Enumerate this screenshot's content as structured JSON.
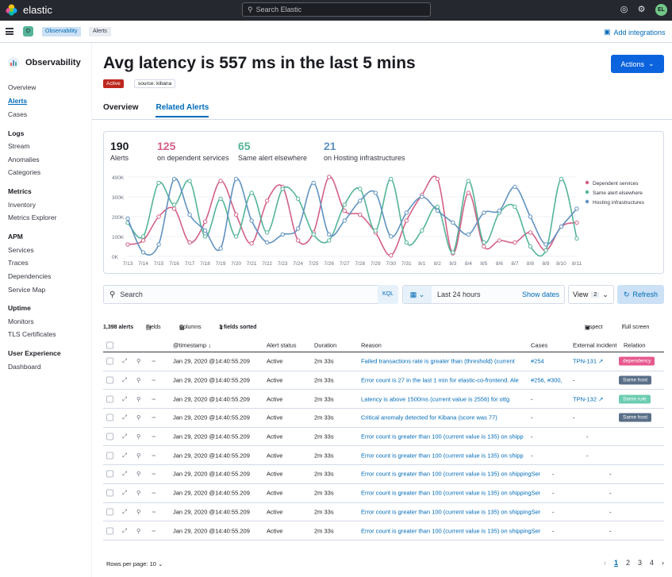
{
  "topbar": {
    "brand": "elastic",
    "search_placeholder": "Search Elastic",
    "avatar_initials": "EL"
  },
  "breadcrumbs": {
    "space_initial": "D",
    "items": [
      "Observability",
      "Alerts"
    ],
    "add_integrations": "Add integrations"
  },
  "sidebar": {
    "title": "Observability",
    "sections": [
      {
        "heading": "",
        "items": [
          "Overview",
          "Alerts",
          "Cases"
        ]
      },
      {
        "heading": "Logs",
        "items": [
          "Stream",
          "Anomalies",
          "Categories"
        ]
      },
      {
        "heading": "Metrics",
        "items": [
          "Inventory",
          "Metrics Explorer"
        ]
      },
      {
        "heading": "APM",
        "items": [
          "Services",
          "Traces",
          "Dependencies",
          "Service Map"
        ]
      },
      {
        "heading": "Uptime",
        "items": [
          "Monitors",
          "TLS Certificates"
        ]
      },
      {
        "heading": "User Experience",
        "items": [
          "Dashboard"
        ]
      }
    ],
    "active_item": "Alerts"
  },
  "page": {
    "title": "Avg latency is 557 ms in the last 5 mins",
    "actions_label": "Actions",
    "status_badge": "Active",
    "source_badge": "source: kibana",
    "tabs": [
      "Overview",
      "Related Alerts"
    ],
    "selected_tab": "Related Alerts"
  },
  "stats": [
    {
      "value": "190",
      "label": "Alerts",
      "color": "#1a1c21"
    },
    {
      "value": "125",
      "label": "on dependent services",
      "color": "#d36086"
    },
    {
      "value": "65",
      "label": "Same alert elsewhere",
      "color": "#54b399"
    },
    {
      "value": "21",
      "label": "on Hosting infrastructures",
      "color": "#6092c0"
    }
  ],
  "chart_data": {
    "type": "line",
    "categories": [
      "7/13",
      "7/14",
      "7/15",
      "7/16",
      "7/17",
      "7/18",
      "7/19",
      "7/20",
      "7/21",
      "7/22",
      "7/23",
      "7/24",
      "7/25",
      "7/26",
      "7/27",
      "7/28",
      "7/29",
      "7/30",
      "7/31",
      "8/1",
      "8/2",
      "8/3",
      "8/4",
      "8/5",
      "8/6",
      "8/7",
      "8/8",
      "8/9",
      "8/10",
      "8/11"
    ],
    "y_ticks": [
      "0K",
      "100K",
      "200K",
      "300K",
      "400K"
    ],
    "ylim": [
      0,
      400
    ],
    "series": [
      {
        "name": "Dependent services",
        "color": "#d36086",
        "values": [
          60,
          80,
          200,
          240,
          70,
          175,
          380,
          210,
          65,
          280,
          350,
          80,
          120,
          400,
          230,
          210,
          120,
          5,
          180,
          310,
          390,
          15,
          320,
          50,
          80,
          70,
          120,
          30,
          150,
          170
        ]
      },
      {
        "name": "Same alert elsewhere",
        "color": "#54b399",
        "values": [
          170,
          100,
          370,
          260,
          380,
          100,
          290,
          100,
          320,
          120,
          340,
          290,
          110,
          80,
          260,
          340,
          130,
          390,
          70,
          130,
          250,
          20,
          380,
          70,
          220,
          250,
          50,
          30,
          390,
          90
        ]
      },
      {
        "name": "Hosting infrastructures",
        "color": "#6092c0",
        "values": [
          190,
          20,
          60,
          390,
          210,
          130,
          40,
          390,
          180,
          70,
          110,
          140,
          370,
          110,
          180,
          280,
          320,
          100,
          220,
          300,
          230,
          170,
          110,
          220,
          230,
          350,
          200,
          60,
          150,
          240
        ]
      }
    ],
    "legend_position": "right",
    "grid": true
  },
  "filters": {
    "search_placeholder": "Search",
    "kql": "KQL",
    "date_range": "Last 24 hours",
    "show_dates": "Show dates",
    "view_label": "View",
    "view_count": "2",
    "refresh": "Refresh"
  },
  "toolbar": {
    "count": "1,398 alerts",
    "fields": "Fields",
    "columns": "Columns",
    "sorted": "1 fields sorted",
    "inspect": "Inspect",
    "fullscreen": "Full screen"
  },
  "table": {
    "columns": [
      "@timestamp",
      "Alert status",
      "Duration",
      "Reason",
      "Cases",
      "External incident",
      "Relation"
    ],
    "rows": [
      {
        "timestamp": "Jan 29, 2020 @14:40:55.209",
        "status": "Active",
        "duration": "2m 33s",
        "reason": "Failed transactions rate is greater than (threshold) (current",
        "cases": "#254",
        "incident": "TPN-131",
        "relation": "dependency",
        "relation_color": "#e7598e"
      },
      {
        "timestamp": "Jan 29, 2020 @14:40:55.209",
        "status": "Active",
        "duration": "2m 33s",
        "reason": "Error count is 27 in the last 1 min for elastic-co-frontend. Ale",
        "cases": "#256, #300,",
        "incident": "-",
        "relation": "Same host",
        "relation_color": "#5a6f87"
      },
      {
        "timestamp": "Jan 29, 2020 @14:40:55.209",
        "status": "Active",
        "duration": "2m 33s",
        "reason": "Latency is above 1500ms (current value is 2556) for ottg",
        "cases": "-",
        "incident": "TPN-132",
        "relation": "Same rule",
        "relation_color": "#6dccb1"
      },
      {
        "timestamp": "Jan 29, 2020 @14:40:55.209",
        "status": "Active",
        "duration": "2m 33s",
        "reason": "Critical anomaly detected for Kibana (score was 77)",
        "cases": "-",
        "incident": "-",
        "relation": "Same host",
        "relation_color": "#5a6f87"
      },
      {
        "timestamp": "Jan 29, 2020 @14:40:55.209",
        "status": "Active",
        "duration": "2m 33s",
        "reason": "Error count is greater than 100 (current value is 135) on shipp",
        "cases": "-",
        "incident": "-",
        "relation": "",
        "relation_color": ""
      },
      {
        "timestamp": "Jan 29, 2020 @14:40:55.209",
        "status": "Active",
        "duration": "2m 33s",
        "reason": "Error count is greater than 100 (current value is 135) on shipp",
        "cases": "-",
        "incident": "-",
        "relation": "",
        "relation_color": ""
      },
      {
        "timestamp": "Jan 29, 2020 @14:40:55.209",
        "status": "Active",
        "duration": "2m 33s",
        "reason": "Error count is greater than 100 (current value is 135) on shippingSer",
        "cases": "-",
        "incident": "-",
        "relation": "",
        "relation_color": ""
      },
      {
        "timestamp": "Jan 29, 2020 @14:40:55.209",
        "status": "Active",
        "duration": "2m 33s",
        "reason": "Error count is greater than 100 (current value is 135) on shippingSer",
        "cases": "-",
        "incident": "-",
        "relation": "",
        "relation_color": ""
      },
      {
        "timestamp": "Jan 29, 2020 @14:40:55.209",
        "status": "Active",
        "duration": "2m 33s",
        "reason": "Error count is greater than 100 (current value is 135) on shippingSer",
        "cases": "-",
        "incident": "-",
        "relation": "",
        "relation_color": ""
      },
      {
        "timestamp": "Jan 29, 2020 @14:40:55.209",
        "status": "Active",
        "duration": "2m 33s",
        "reason": "Error count is greater than 100 (current value is 135) on shippingSer",
        "cases": "-",
        "incident": "-",
        "relation": "",
        "relation_color": ""
      }
    ]
  },
  "pagination": {
    "rows_per_page": "Rows per page: 10",
    "pages": [
      "1",
      "2",
      "3",
      "4"
    ],
    "current_page": "1"
  }
}
